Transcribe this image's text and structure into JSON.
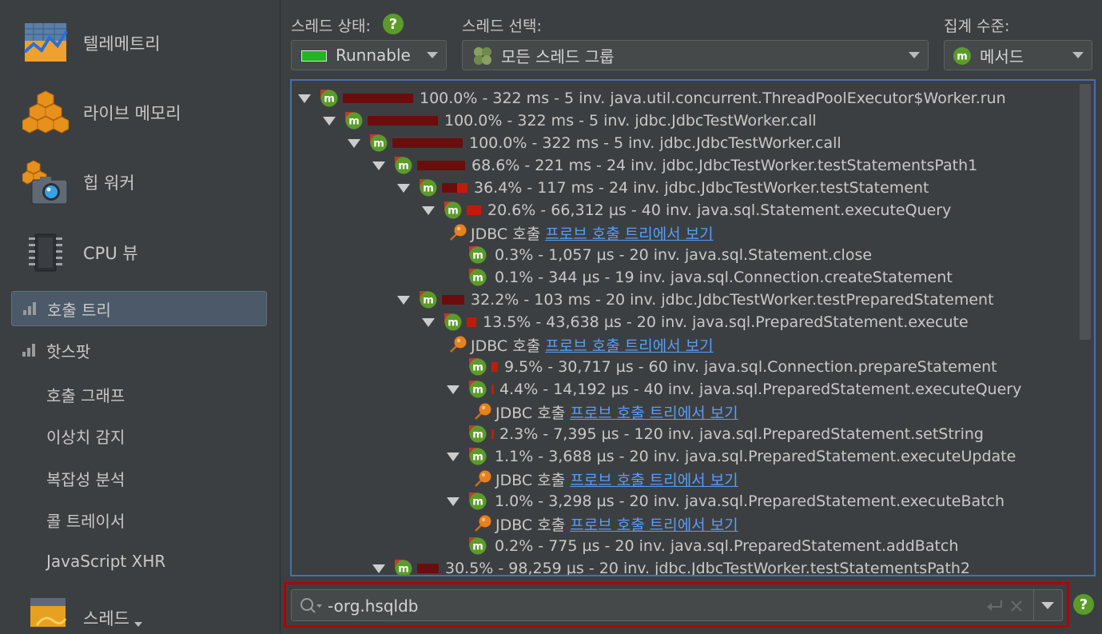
{
  "sidebar": {
    "items": [
      {
        "label": "텔레메트리",
        "icon": "telemetry-icon"
      },
      {
        "label": "라이브 메모리",
        "icon": "live-memory-icon"
      },
      {
        "label": "힙 워커",
        "icon": "heap-walker-icon"
      },
      {
        "label": "CPU 뷰",
        "icon": "cpu-chip-icon"
      }
    ],
    "selected_label": "호출 트리",
    "hotspots_label": "핫스팟",
    "sub_items": [
      "호출 그래프",
      "이상치 감지",
      "복잡성 분석",
      "콜 트레이서",
      "JavaScript XHR"
    ],
    "threads_label": "스레드"
  },
  "toolbar": {
    "thread_status_label": "스레드 상태:",
    "thread_status_value": "Runnable",
    "thread_select_label": "스레드 선택:",
    "thread_select_value": "모든 스레드 그룹",
    "aggregation_label": "집계 수준:",
    "aggregation_value": "메서드",
    "help": "?"
  },
  "tree": {
    "link_prefix": "JDBC 호출",
    "link_text": "프로브 호출 트리에서 보기",
    "rows": [
      {
        "text": "100.0% - 322 ms - 5 inv. java.util.concurrent.ThreadPoolExecutor$Worker.run",
        "pct": 100.0,
        "self": 0
      },
      {
        "text": "100.0% - 322 ms - 5 inv. jdbc.JdbcTestWorker.call",
        "pct": 100.0,
        "self": 0
      },
      {
        "text": "100.0% - 322 ms - 5 inv. jdbc.JdbcTestWorker.call",
        "pct": 100.0,
        "self": 0
      },
      {
        "text": "68.6% - 221 ms - 24 inv. jdbc.JdbcTestWorker.testStatementsPath1",
        "pct": 68.6,
        "self": 0
      },
      {
        "text": "36.4% - 117 ms - 24 inv. jdbc.JdbcTestWorker.testStatement",
        "pct": 36.4,
        "self": 15
      },
      {
        "text": "20.6% - 66,312 µs - 40 inv. java.sql.Statement.executeQuery",
        "pct": 20.6,
        "self": 20.6
      },
      {
        "link": true
      },
      {
        "text": "0.3% - 1,057 µs - 20 inv. java.sql.Statement.close",
        "pct": 0.3,
        "self": 0.3
      },
      {
        "text": "0.1% - 344 µs - 19 inv. java.sql.Connection.createStatement",
        "pct": 0.1,
        "self": 0.1
      },
      {
        "text": "32.2% - 103 ms - 20 inv. jdbc.JdbcTestWorker.testPreparedStatement",
        "pct": 32.2,
        "self": 0
      },
      {
        "text": "13.5% - 43,638 µs - 20 inv. java.sql.PreparedStatement.execute",
        "pct": 13.5,
        "self": 13.5
      },
      {
        "link": true
      },
      {
        "text": "9.5% - 30,717 µs - 60 inv. java.sql.Connection.prepareStatement",
        "pct": 9.5,
        "self": 9.5
      },
      {
        "text": "4.4% - 14,192 µs - 40 inv. java.sql.PreparedStatement.executeQuery",
        "pct": 4.4,
        "self": 4.4
      },
      {
        "link": true
      },
      {
        "text": "2.3% - 7,395 µs - 120 inv. java.sql.PreparedStatement.setString",
        "pct": 2.3,
        "self": 2.3
      },
      {
        "text": "1.1% - 3,688 µs - 20 inv. java.sql.PreparedStatement.executeUpdate",
        "pct": 1.1,
        "self": 1.1
      },
      {
        "link": true
      },
      {
        "text": "1.0% - 3,298 µs - 20 inv. java.sql.PreparedStatement.executeBatch",
        "pct": 1.0,
        "self": 1.0
      },
      {
        "link": true
      },
      {
        "text": "0.2% - 775 µs - 20 inv. java.sql.PreparedStatement.addBatch",
        "pct": 0.2,
        "self": 0.2
      },
      {
        "text": "30.5% - 98,259 µs - 20 inv. jdbc.JdbcTestWorker.testStatementsPath2",
        "pct": 30.5,
        "self": 0
      }
    ]
  },
  "search": {
    "value": "-org.hsqldb"
  },
  "colors": {
    "accent_border": "#4b6ea8",
    "search_highlight": "#b30000",
    "method_icon": "#5b9b2a",
    "bar_total": "#6b0d0d",
    "bar_self": "#c21a0a",
    "link": "#589df6"
  }
}
